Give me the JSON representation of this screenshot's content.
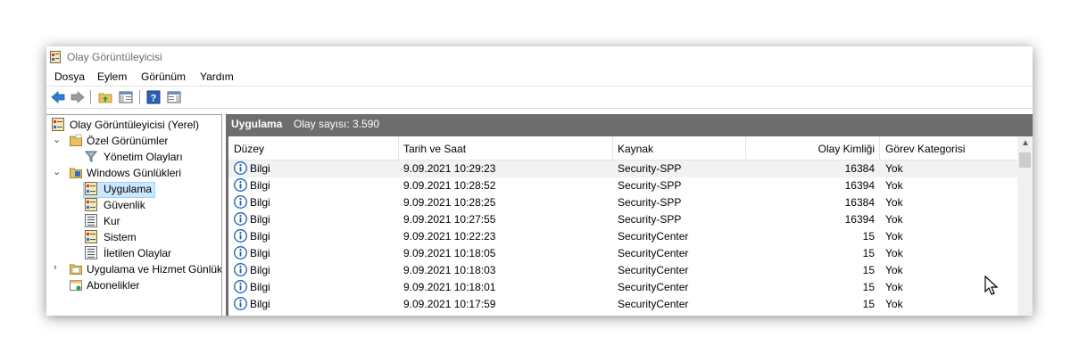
{
  "window": {
    "title": "Olay Görüntüleyicisi"
  },
  "menu": [
    "Dosya",
    "Eylem",
    "Görünüm",
    "Yardım"
  ],
  "toolbar": [
    "back-icon",
    "forward-icon",
    "up-folder-icon",
    "show-hide-tree-icon",
    "help-icon",
    "show-hide-action-pane-icon"
  ],
  "tree": {
    "root": "Olay Görüntüleyicisi (Yerel)",
    "custom_views": "Özel Görünümler",
    "admin_events": "Yönetim Olayları",
    "windows_logs": "Windows Günlükleri",
    "application": "Uygulama",
    "security": "Güvenlik",
    "setup": "Kur",
    "system": "Sistem",
    "forwarded": "İletilen Olaylar",
    "app_service_logs": "Uygulama ve Hizmet Günlükleri",
    "subscriptions": "Abonelikler"
  },
  "panel": {
    "title": "Uygulama",
    "count_label": "Olay sayısı: 3.590"
  },
  "columns": [
    "Düzey",
    "Tarih ve Saat",
    "Kaynak",
    "Olay Kimliği",
    "Görev Kategorisi"
  ],
  "rows": [
    {
      "level": "Bilgi",
      "datetime": "9.09.2021 10:29:23",
      "source": "Security-SPP",
      "event_id": "16384",
      "category": "Yok"
    },
    {
      "level": "Bilgi",
      "datetime": "9.09.2021 10:28:52",
      "source": "Security-SPP",
      "event_id": "16394",
      "category": "Yok"
    },
    {
      "level": "Bilgi",
      "datetime": "9.09.2021 10:28:25",
      "source": "Security-SPP",
      "event_id": "16384",
      "category": "Yok"
    },
    {
      "level": "Bilgi",
      "datetime": "9.09.2021 10:27:55",
      "source": "Security-SPP",
      "event_id": "16394",
      "category": "Yok"
    },
    {
      "level": "Bilgi",
      "datetime": "9.09.2021 10:22:23",
      "source": "SecurityCenter",
      "event_id": "15",
      "category": "Yok"
    },
    {
      "level": "Bilgi",
      "datetime": "9.09.2021 10:18:05",
      "source": "SecurityCenter",
      "event_id": "15",
      "category": "Yok"
    },
    {
      "level": "Bilgi",
      "datetime": "9.09.2021 10:18:03",
      "source": "SecurityCenter",
      "event_id": "15",
      "category": "Yok"
    },
    {
      "level": "Bilgi",
      "datetime": "9.09.2021 10:18:01",
      "source": "SecurityCenter",
      "event_id": "15",
      "category": "Yok"
    },
    {
      "level": "Bilgi",
      "datetime": "9.09.2021 10:17:59",
      "source": "SecurityCenter",
      "event_id": "15",
      "category": "Yok"
    }
  ],
  "colors": {
    "header_gray": "#6e6e6e",
    "selection": "#cce8ff",
    "info_blue": "#1c5fb8"
  }
}
